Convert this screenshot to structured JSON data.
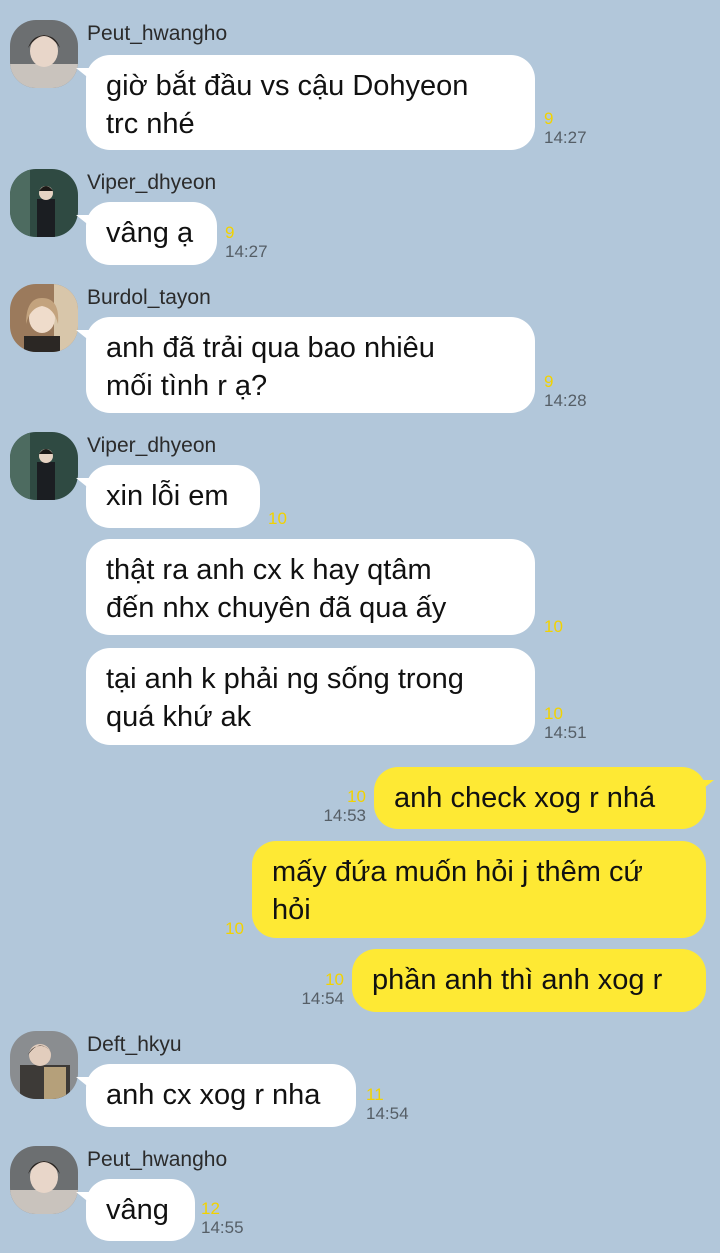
{
  "colors": {
    "background": "#b2c7da",
    "incoming_bubble": "#ffffff",
    "outgoing_bubble": "#fee934",
    "unread_count": "#f2d200"
  },
  "messages": [
    {
      "sender": "Peut_hwangho",
      "text": "giờ bắt đầu vs cậu Dohyeon\ntrc nhé",
      "unread": "9",
      "time": "14:27"
    },
    {
      "sender": "Viper_dhyeon",
      "text": "vâng ạ",
      "unread": "9",
      "time": "14:27"
    },
    {
      "sender": "Burdol_tayon",
      "text": "anh đã trải qua bao nhiêu\nmối tình r ạ?",
      "unread": "9",
      "time": "14:28"
    },
    {
      "sender": "Viper_dhyeon",
      "text": "xin lỗi em",
      "unread": "10",
      "time": ""
    },
    {
      "sender": "",
      "text": "thật ra anh cx k hay qtâm\nđến nhx chuyên đã qua ấy",
      "unread": "10",
      "time": ""
    },
    {
      "sender": "",
      "text": "tại anh k phải ng sống trong\nquá khứ ak",
      "unread": "10",
      "time": "14:51"
    },
    {
      "sender": "me",
      "text": "anh check xog r nhá",
      "unread": "10",
      "time": "14:53"
    },
    {
      "sender": "me",
      "text": "mấy đứa muốn hỏi j thêm cứ\nhỏi",
      "unread": "10",
      "time": ""
    },
    {
      "sender": "me",
      "text": "phần anh thì anh xog r",
      "unread": "10",
      "time": "14:54"
    },
    {
      "sender": "Deft_hkyu",
      "text": "anh cx xog r nha",
      "unread": "11",
      "time": "14:54"
    },
    {
      "sender": "Peut_hwangho",
      "text": "vâng",
      "unread": "12",
      "time": "14:55"
    }
  ]
}
